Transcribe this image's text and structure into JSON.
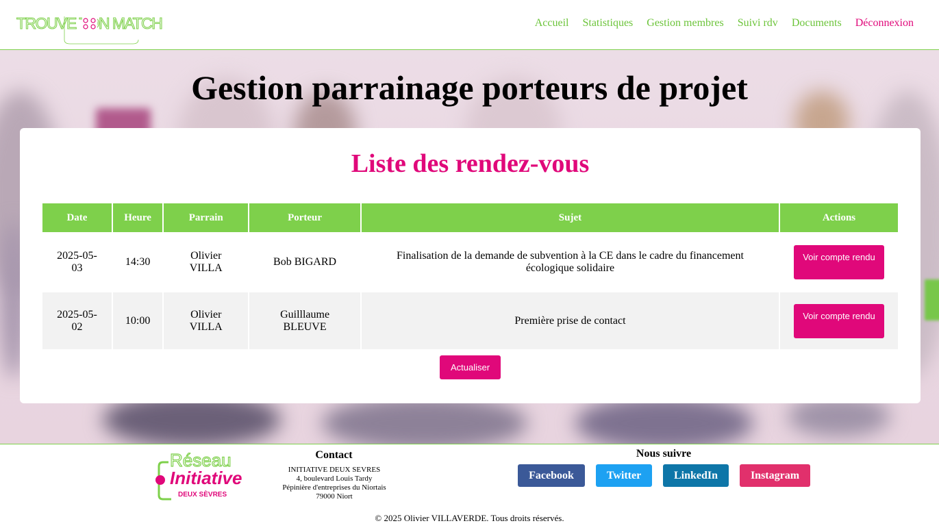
{
  "brand": {
    "logo_text": "TROUVE TON MATCH"
  },
  "nav": {
    "items": [
      "Accueil",
      "Statistiques",
      "Gestion membres",
      "Suivi rdv",
      "Documents"
    ],
    "logout": "Déconnexion"
  },
  "page": {
    "title": "Gestion parrainage porteurs de projet"
  },
  "card": {
    "title": "Liste des rendez-vous",
    "columns": [
      "Date",
      "Heure",
      "Parrain",
      "Porteur",
      "Sujet",
      "Actions"
    ],
    "rows": [
      {
        "date": "2025-05-03",
        "heure": "14:30",
        "parrain": "Olivier VILLA",
        "porteur": "Bob BIGARD",
        "sujet": "Finalisation de la demande de subvention à la CE dans le cadre du financement écologique solidaire",
        "action": "Voir compte rendu"
      },
      {
        "date": "2025-05-02",
        "heure": "10:00",
        "parrain": "Olivier VILLA",
        "porteur": "Guilllaume BLEUVE",
        "sujet": "Première prise de contact",
        "action": "Voir compte rendu"
      }
    ],
    "refresh_label": "Actualiser"
  },
  "footer": {
    "logo": {
      "line1": "Réseau",
      "line2": "Initiative",
      "line3": "DEUX SÈVRES"
    },
    "contact_title": "Contact",
    "contact_lines": [
      "INITIATIVE DEUX SEVRES",
      "4, boulevard Louis Tardy",
      "Pépinière d'entreprises du Niortais",
      "79000 Niort"
    ],
    "follow_title": "Nous suivre",
    "socials": [
      {
        "label": "Facebook",
        "color": "#3b5998"
      },
      {
        "label": "Twitter",
        "color": "#1da1f2"
      },
      {
        "label": "LinkedIn",
        "color": "#0e76a8"
      },
      {
        "label": "Instagram",
        "color": "#e1306c"
      }
    ],
    "copyright": "© 2025 Olivier VILLAVERDE. Tous droits réservés."
  },
  "colors": {
    "accent_green": "#7ed04b",
    "accent_pink": "#e0087a"
  }
}
